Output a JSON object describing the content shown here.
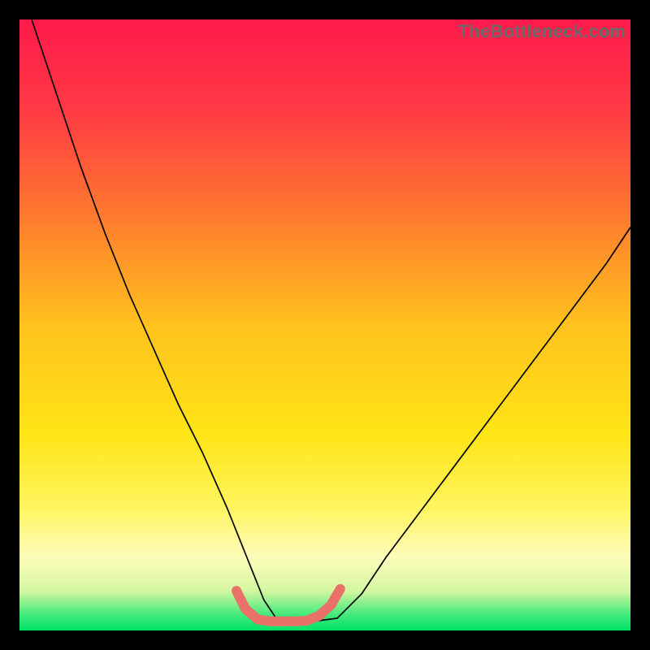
{
  "watermark": "TheBottleneck.com",
  "chart_data": {
    "type": "line",
    "title": "",
    "xlabel": "",
    "ylabel": "",
    "xlim": [
      0,
      100
    ],
    "ylim": [
      0,
      100
    ],
    "grid": false,
    "legend": false,
    "background_gradient": {
      "stops": [
        {
          "offset": 0.0,
          "color": "#ff1a4b"
        },
        {
          "offset": 0.15,
          "color": "#ff3a44"
        },
        {
          "offset": 0.32,
          "color": "#ff7a2e"
        },
        {
          "offset": 0.5,
          "color": "#ffc21e"
        },
        {
          "offset": 0.68,
          "color": "#ffe516"
        },
        {
          "offset": 0.8,
          "color": "#fff560"
        },
        {
          "offset": 0.88,
          "color": "#fdfcbb"
        },
        {
          "offset": 0.935,
          "color": "#d4f7a0"
        },
        {
          "offset": 0.975,
          "color": "#3fe97a"
        },
        {
          "offset": 1.0,
          "color": "#00e267"
        }
      ]
    },
    "series": [
      {
        "name": "curve",
        "color": "#000000",
        "width": 1.7,
        "x": [
          2,
          6,
          10,
          14,
          18,
          22,
          26,
          30,
          34,
          36,
          38,
          40,
          42,
          44,
          48,
          52,
          56,
          60,
          66,
          72,
          78,
          84,
          90,
          96,
          100
        ],
        "y": [
          100,
          88,
          76,
          65,
          55,
          46,
          37,
          29,
          20,
          15,
          10,
          5,
          2,
          1.5,
          1.5,
          2,
          6,
          12,
          20,
          28,
          36,
          44,
          52,
          60,
          66
        ]
      },
      {
        "name": "bottom-highlight",
        "color": "#e9716a",
        "width": 12,
        "linecap": "round",
        "x": [
          35.5,
          37,
          39,
          41,
          43,
          45,
          47,
          49,
          51,
          52.5
        ],
        "y": [
          6.5,
          3.5,
          1.8,
          1.5,
          1.5,
          1.5,
          1.6,
          2.4,
          4.2,
          6.8
        ]
      }
    ]
  }
}
